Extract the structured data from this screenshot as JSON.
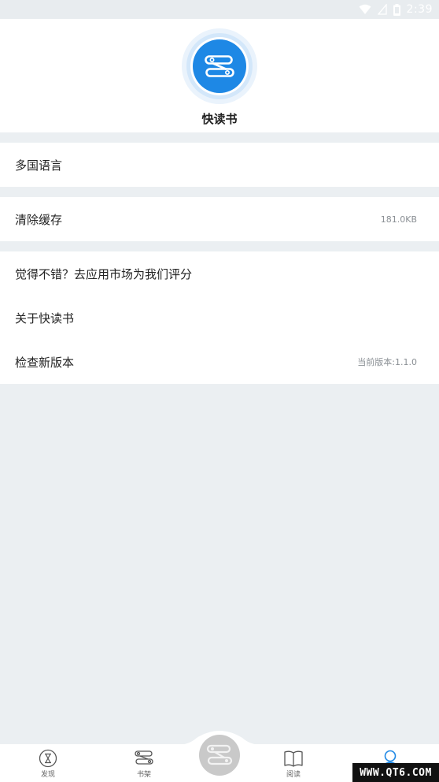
{
  "status_bar": {
    "time": "2:39"
  },
  "header": {
    "app_name": "快读书",
    "logo_icon": "book-shelf-logo-icon",
    "accent_color": "#1e88e5"
  },
  "settings": {
    "group1": [
      {
        "label": "多国语言",
        "value": ""
      }
    ],
    "group2": [
      {
        "label": "清除缓存",
        "value": "181.0KB"
      }
    ],
    "group3": [
      {
        "label": "觉得不错？去应用市场为我们评分",
        "value": ""
      },
      {
        "label": "关于快读书",
        "value": ""
      },
      {
        "label": "检查新版本",
        "value": "当前版本:1.1.0"
      }
    ]
  },
  "bottom_nav": {
    "items": [
      {
        "label": "发现",
        "icon": "hourglass-icon"
      },
      {
        "label": "书架",
        "icon": "bookshelf-icon"
      },
      {
        "label": "阅读",
        "icon": "open-book-icon"
      },
      {
        "label": "",
        "icon": "user-icon",
        "active": true
      }
    ],
    "active_color": "#1e88e5"
  },
  "watermark": {
    "text": "WWW.QT6.COM"
  }
}
